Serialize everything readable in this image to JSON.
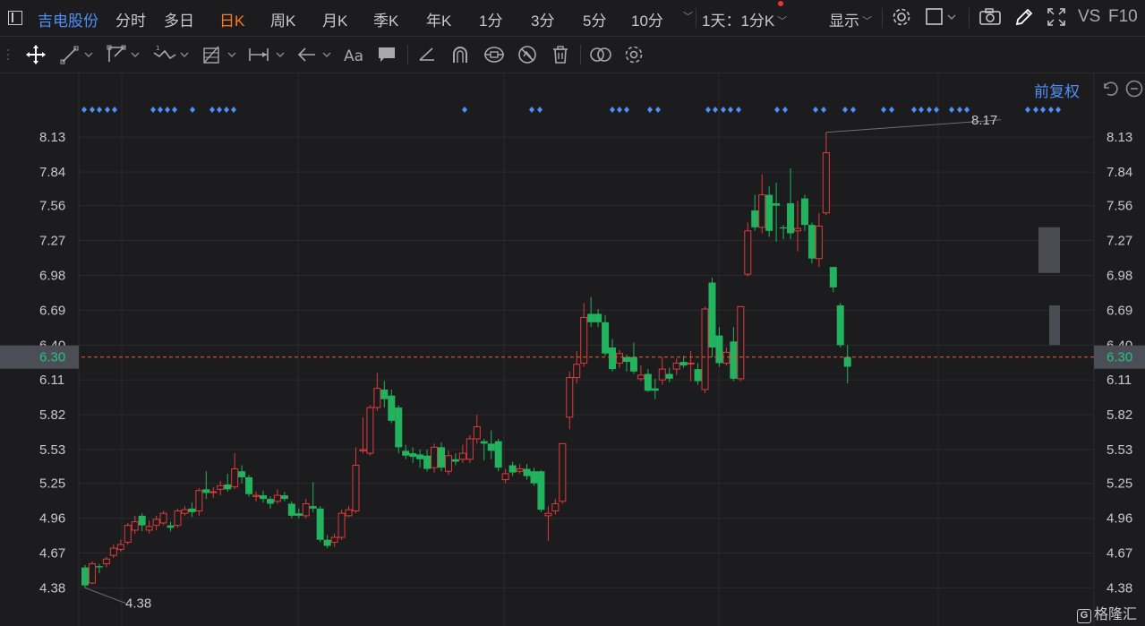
{
  "topbar": {
    "stock_name": "吉电股份",
    "periods": [
      "分时",
      "多日",
      "日K",
      "周K",
      "月K",
      "季K",
      "年K",
      "1分",
      "3分",
      "5分",
      "10分"
    ],
    "active_period": "日K",
    "combo": "1天：1分K",
    "display": "显示",
    "vs": "VS",
    "f10": "F10"
  },
  "adjust_label": "前复权",
  "price_labels": [
    "8.13",
    "7.84",
    "7.56",
    "7.27",
    "6.98",
    "6.69",
    "6.40",
    "6.11",
    "5.82",
    "5.53",
    "5.25",
    "4.96",
    "4.67",
    "4.38"
  ],
  "current_price": "6.30",
  "high_label": "8.17",
  "low_label": "4.38",
  "watermark": "格隆汇",
  "colors": {
    "up": "#e03a3a",
    "down": "#22b35e",
    "accent": "#4f8ff7",
    "active": "#ff7a1a",
    "bg": "#1c1c1e"
  },
  "chart_data": {
    "type": "candlestick",
    "ylim": [
      4.3,
      8.3
    ],
    "y_ticks": [
      8.13,
      7.84,
      7.56,
      7.27,
      6.98,
      6.69,
      6.4,
      6.11,
      5.82,
      5.53,
      5.25,
      4.96,
      4.67,
      4.38
    ],
    "current_price": 6.3,
    "high": 8.17,
    "low": 4.38,
    "candles": [
      [
        4.55,
        4.4,
        4.57,
        4.38
      ],
      [
        4.42,
        4.58,
        4.6,
        4.41
      ],
      [
        4.56,
        4.55,
        4.58,
        4.5
      ],
      [
        4.58,
        4.62,
        4.64,
        4.55
      ],
      [
        4.65,
        4.71,
        4.74,
        4.63
      ],
      [
        4.7,
        4.74,
        4.78,
        4.68
      ],
      [
        4.76,
        4.9,
        4.92,
        4.74
      ],
      [
        4.86,
        4.93,
        4.98,
        4.83
      ],
      [
        4.98,
        4.9,
        5.0,
        4.85
      ],
      [
        4.86,
        4.89,
        4.94,
        4.83
      ],
      [
        4.9,
        4.95,
        4.98,
        4.86
      ],
      [
        4.92,
        5.0,
        5.02,
        4.9
      ],
      [
        4.9,
        4.88,
        4.93,
        4.85
      ],
      [
        4.9,
        5.02,
        5.04,
        4.88
      ],
      [
        5.0,
        5.03,
        5.06,
        4.98
      ],
      [
        5.04,
        5.01,
        5.09,
        4.97
      ],
      [
        5.02,
        5.19,
        5.21,
        4.98
      ],
      [
        5.2,
        5.17,
        5.35,
        5.12
      ],
      [
        5.18,
        5.18,
        5.22,
        5.13
      ],
      [
        5.2,
        5.23,
        5.27,
        5.15
      ],
      [
        5.24,
        5.2,
        5.33,
        5.18
      ],
      [
        5.22,
        5.37,
        5.5,
        5.2
      ],
      [
        5.35,
        5.3,
        5.4,
        5.25
      ],
      [
        5.3,
        5.16,
        5.32,
        5.14
      ],
      [
        5.14,
        5.15,
        5.18,
        5.1
      ],
      [
        5.15,
        5.12,
        5.19,
        5.09
      ],
      [
        5.12,
        5.08,
        5.14,
        5.04
      ],
      [
        5.1,
        5.15,
        5.2,
        5.08
      ],
      [
        5.15,
        5.12,
        5.18,
        5.1
      ],
      [
        5.08,
        4.98,
        5.1,
        4.96
      ],
      [
        5.0,
        4.98,
        5.04,
        4.96
      ],
      [
        4.98,
        5.08,
        5.12,
        4.96
      ],
      [
        5.06,
        5.04,
        5.26,
        5.01
      ],
      [
        5.04,
        4.78,
        5.06,
        4.76
      ],
      [
        4.78,
        4.73,
        4.82,
        4.71
      ],
      [
        4.76,
        4.8,
        4.83,
        4.72
      ],
      [
        4.8,
        5.0,
        5.03,
        4.78
      ],
      [
        4.98,
        5.03,
        5.06,
        4.97
      ],
      [
        5.02,
        5.4,
        5.55,
        5.0
      ],
      [
        5.52,
        5.53,
        5.8,
        5.5
      ],
      [
        5.5,
        5.88,
        5.9,
        5.48
      ],
      [
        5.88,
        6.04,
        6.17,
        5.85
      ],
      [
        6.03,
        5.95,
        6.1,
        5.88
      ],
      [
        5.98,
        5.77,
        6.03,
        5.75
      ],
      [
        5.88,
        5.55,
        5.9,
        5.5
      ],
      [
        5.52,
        5.48,
        5.57,
        5.45
      ],
      [
        5.5,
        5.47,
        5.55,
        5.42
      ],
      [
        5.49,
        5.45,
        5.53,
        5.38
      ],
      [
        5.48,
        5.37,
        5.53,
        5.35
      ],
      [
        5.38,
        5.55,
        5.58,
        5.34
      ],
      [
        5.55,
        5.38,
        5.59,
        5.35
      ],
      [
        5.35,
        5.48,
        5.52,
        5.32
      ],
      [
        5.45,
        5.43,
        5.5,
        5.4
      ],
      [
        5.45,
        5.5,
        5.57,
        5.42
      ],
      [
        5.45,
        5.62,
        5.65,
        5.42
      ],
      [
        5.62,
        5.72,
        5.82,
        5.58
      ],
      [
        5.6,
        5.58,
        5.62,
        5.44
      ],
      [
        5.58,
        5.52,
        5.69,
        5.45
      ],
      [
        5.6,
        5.38,
        5.62,
        5.35
      ],
      [
        5.28,
        5.33,
        5.37,
        5.25
      ],
      [
        5.4,
        5.34,
        5.43,
        5.31
      ],
      [
        5.35,
        5.37,
        5.41,
        5.33
      ],
      [
        5.37,
        5.31,
        5.41,
        5.28
      ],
      [
        5.35,
        5.25,
        5.38,
        5.23
      ],
      [
        5.35,
        5.03,
        5.36,
        5.01
      ],
      [
        4.98,
        5.0,
        5.06,
        4.77
      ],
      [
        5.02,
        5.08,
        5.12,
        4.99
      ],
      [
        5.1,
        5.58,
        5.58,
        5.08
      ],
      [
        5.8,
        6.13,
        6.18,
        5.7
      ],
      [
        6.13,
        6.24,
        6.35,
        6.08
      ],
      [
        6.25,
        6.63,
        6.75,
        6.22
      ],
      [
        6.66,
        6.59,
        6.8,
        6.55
      ],
      [
        6.66,
        6.59,
        6.7,
        6.55
      ],
      [
        6.59,
        6.33,
        6.65,
        6.31
      ],
      [
        6.38,
        6.2,
        6.45,
        6.18
      ],
      [
        6.25,
        6.33,
        6.36,
        6.21
      ],
      [
        6.3,
        6.26,
        6.32,
        6.18
      ],
      [
        6.3,
        6.18,
        6.42,
        6.16
      ],
      [
        6.12,
        6.15,
        6.23,
        6.1
      ],
      [
        6.16,
        6.02,
        6.2,
        6.01
      ],
      [
        6.04,
        6.02,
        6.12,
        5.95
      ],
      [
        6.11,
        6.2,
        6.3,
        6.07
      ],
      [
        6.16,
        6.12,
        6.21,
        6.09
      ],
      [
        6.2,
        6.25,
        6.29,
        6.15
      ],
      [
        6.26,
        6.23,
        6.31,
        6.21
      ],
      [
        6.25,
        6.25,
        6.35,
        6.1
      ],
      [
        6.2,
        6.1,
        6.25,
        6.07
      ],
      [
        6.03,
        6.7,
        6.72,
        6.0
      ],
      [
        6.92,
        6.38,
        6.96,
        6.3
      ],
      [
        6.48,
        6.25,
        6.55,
        6.22
      ],
      [
        6.25,
        6.34,
        6.38,
        6.23
      ],
      [
        6.43,
        6.12,
        6.55,
        6.1
      ],
      [
        6.12,
        6.72,
        6.72,
        6.1
      ],
      [
        6.99,
        7.35,
        7.42,
        6.97
      ],
      [
        7.52,
        7.38,
        7.65,
        7.35
      ],
      [
        7.38,
        7.65,
        7.82,
        7.33
      ],
      [
        7.65,
        7.35,
        7.72,
        7.3
      ],
      [
        7.58,
        7.56,
        7.75,
        7.26
      ],
      [
        7.38,
        7.37,
        7.4,
        7.28
      ],
      [
        7.58,
        7.33,
        7.87,
        7.28
      ],
      [
        7.35,
        7.37,
        7.6,
        7.18
      ],
      [
        7.62,
        7.4,
        7.65,
        7.35
      ],
      [
        7.4,
        7.12,
        7.42,
        7.08
      ],
      [
        7.12,
        7.39,
        7.5,
        7.05
      ],
      [
        7.5,
        8.0,
        8.17,
        7.48
      ],
      [
        7.05,
        6.88,
        7.0,
        6.84
      ],
      [
        6.73,
        6.4,
        6.75,
        6.38
      ],
      [
        6.3,
        6.22,
        6.4,
        6.08
      ]
    ]
  }
}
